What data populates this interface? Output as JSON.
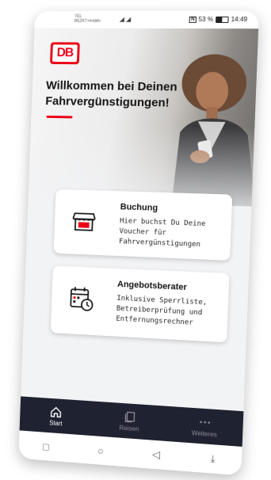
{
  "status_bar": {
    "carrier_line1": "TEL",
    "carrier_line2": "BEZKT+mobilv",
    "signal_text": "◢ ◢",
    "battery_percent": "53 %",
    "time": "14:49",
    "nfc_label": "N"
  },
  "hero": {
    "logo_text": "DB",
    "welcome_text": "Willkommen bei Deinen Fahrvergünstigungen!"
  },
  "cards": [
    {
      "title": "Buchung",
      "text": "Hier buchst Du Deine Voucher für Fahrvergünstigungen",
      "icon": "shop-icon"
    },
    {
      "title": "Angebotsberater",
      "text": "Inklusive Sperrliste, Betreiberprüfung und Entfernungsrechner",
      "icon": "calendar-clock-icon"
    }
  ],
  "bottom_nav": [
    {
      "label": "Start",
      "icon": "home-icon",
      "active": true
    },
    {
      "label": "Reisen",
      "icon": "tickets-icon",
      "active": false
    },
    {
      "label": "Weiteres",
      "icon": "more-dots-icon",
      "active": false
    }
  ],
  "system_nav": {
    "square_glyph": "□",
    "circle_glyph": "○",
    "back_glyph": "◁",
    "down_glyph": "⤓"
  },
  "colors": {
    "brand_red": "#ec0016",
    "nav_bg": "#1f2230"
  }
}
